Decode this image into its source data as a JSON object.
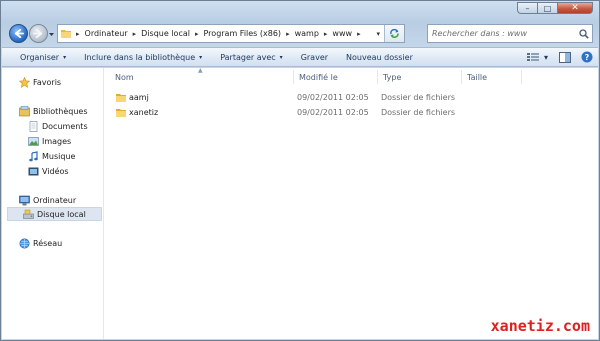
{
  "window": {
    "controls": {
      "minimize": "–",
      "maximize": "□",
      "close": "✕"
    }
  },
  "address": {
    "crumbs": [
      "Ordinateur",
      "Disque local",
      "Program Files (x86)",
      "wamp",
      "www"
    ],
    "separator": "▸",
    "dropdown": "▾"
  },
  "search": {
    "placeholder": "Rechercher dans : www"
  },
  "toolbar": {
    "organize": "Organiser",
    "include": "Inclure dans la bibliothèque",
    "share": "Partager avec",
    "burn": "Graver",
    "new_folder": "Nouveau dossier",
    "arrow": "▾"
  },
  "sidebar": {
    "favorites": "Favoris",
    "libraries": "Bibliothèques",
    "documents": "Documents",
    "images": "Images",
    "music": "Musique",
    "videos": "Vidéos",
    "computer": "Ordinateur",
    "local_disk": "Disque local",
    "network": "Réseau"
  },
  "columns": {
    "name": "Nom",
    "modified": "Modifié le",
    "type": "Type",
    "size": "Taille",
    "sort_indicator": "▲"
  },
  "files": [
    {
      "name": "aamj",
      "modified": "09/02/2011 02:05",
      "type": "Dossier de fichiers"
    },
    {
      "name": "xanetiz",
      "modified": "09/02/2011 02:05",
      "type": "Dossier de fichiers"
    }
  ],
  "watermark": "xanetiz.com",
  "colors": {
    "folder": "#f2c94c",
    "selection": "#dde6f0",
    "watermark": "#e02020",
    "toolbar_text": "#1e395b"
  }
}
